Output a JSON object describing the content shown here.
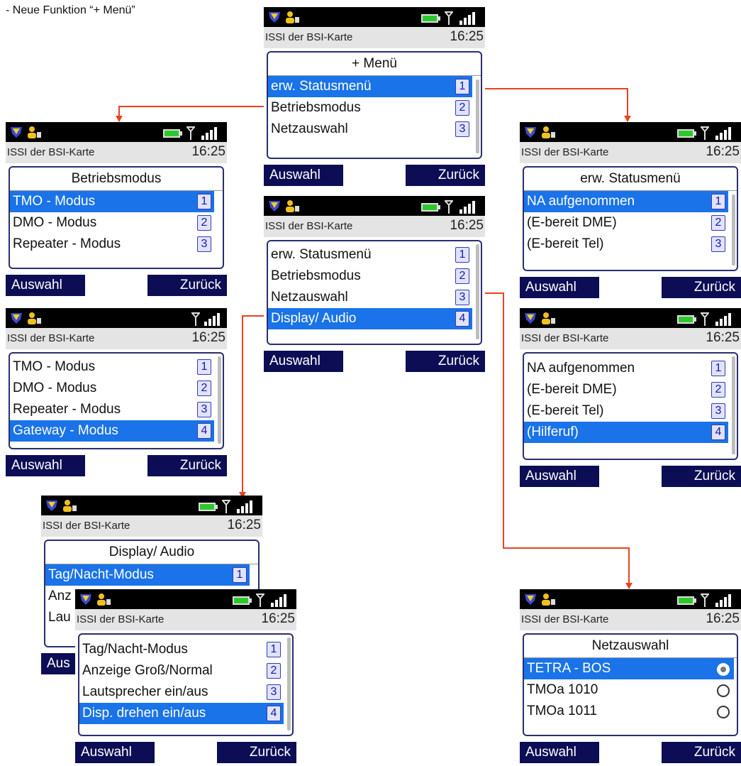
{
  "heading": "- Neue Funktion “+ Menü”",
  "status": {
    "issi": "ISSI der BSI-Karte",
    "time": "16:25"
  },
  "softkeys": {
    "left": "Auswahl",
    "right": "Zurück"
  },
  "icons": [
    "shield-icon",
    "user-icon",
    "battery-icon",
    "antenna-icon",
    "signal-bars-icon"
  ],
  "colors": {
    "selection": "#1a73e8",
    "softkey": "#0d0d55",
    "arrow": "#e8431f",
    "panel_border": "#2a2e6f"
  },
  "screens": {
    "plus_menu": {
      "title": "+ Menü",
      "items": [
        {
          "label": "erw. Statusmenü",
          "num": "1"
        },
        {
          "label": "Betriebsmodus",
          "num": "2"
        },
        {
          "label": "Netzauswahl",
          "num": "3"
        }
      ]
    },
    "betriebsmodus": {
      "title": "Betriebsmodus",
      "items": [
        {
          "label": "TMO - Modus",
          "num": "1"
        },
        {
          "label": "DMO - Modus",
          "num": "2"
        },
        {
          "label": "Repeater - Modus",
          "num": "3"
        }
      ]
    },
    "betriebsmodus_list": {
      "items": [
        {
          "label": "TMO - Modus",
          "num": "1"
        },
        {
          "label": "DMO - Modus",
          "num": "2"
        },
        {
          "label": "Repeater - Modus",
          "num": "3"
        },
        {
          "label": "Gateway - Modus",
          "num": "4"
        }
      ]
    },
    "plus_menu_list": {
      "items": [
        {
          "label": "erw. Statusmenü",
          "num": "1"
        },
        {
          "label": "Betriebsmodus",
          "num": "2"
        },
        {
          "label": "Netzauswahl",
          "num": "3"
        },
        {
          "label": "Display/ Audio",
          "num": "4"
        }
      ]
    },
    "erw_status": {
      "title": "erw. Statusmenü",
      "items": [
        {
          "label": "NA aufgenommen",
          "num": "1"
        },
        {
          "label": "(E-bereit DME)",
          "num": "2"
        },
        {
          "label": "(E-bereit Tel)",
          "num": "3"
        }
      ]
    },
    "erw_status_list": {
      "items": [
        {
          "label": "NA aufgenommen",
          "num": "1"
        },
        {
          "label": "(E-bereit DME)",
          "num": "2"
        },
        {
          "label": "(E-bereit Tel)",
          "num": "3"
        },
        {
          "label": "(Hilferuf)",
          "num": "4"
        }
      ]
    },
    "display_audio": {
      "title": "Display/ Audio",
      "items": [
        {
          "label": "Tag/Nacht-Modus",
          "num": "1"
        },
        {
          "label": "Anz",
          "num": ""
        },
        {
          "label": "Lau",
          "num": ""
        }
      ],
      "softkey_left_partial": "Aus"
    },
    "display_audio_list": {
      "items": [
        {
          "label": "Tag/Nacht-Modus",
          "num": "1"
        },
        {
          "label": "Anzeige Groß/Normal",
          "num": "2"
        },
        {
          "label": "Lautsprecher ein/aus",
          "num": "3"
        },
        {
          "label": "Disp. drehen ein/aus",
          "num": "4"
        }
      ]
    },
    "netzauswahl": {
      "title": "Netzauswahl",
      "items": [
        {
          "label": "TETRA - BOS",
          "selected": true
        },
        {
          "label": "TMOa 1010",
          "selected": false
        },
        {
          "label": "TMOa 1011",
          "selected": false
        }
      ]
    }
  }
}
